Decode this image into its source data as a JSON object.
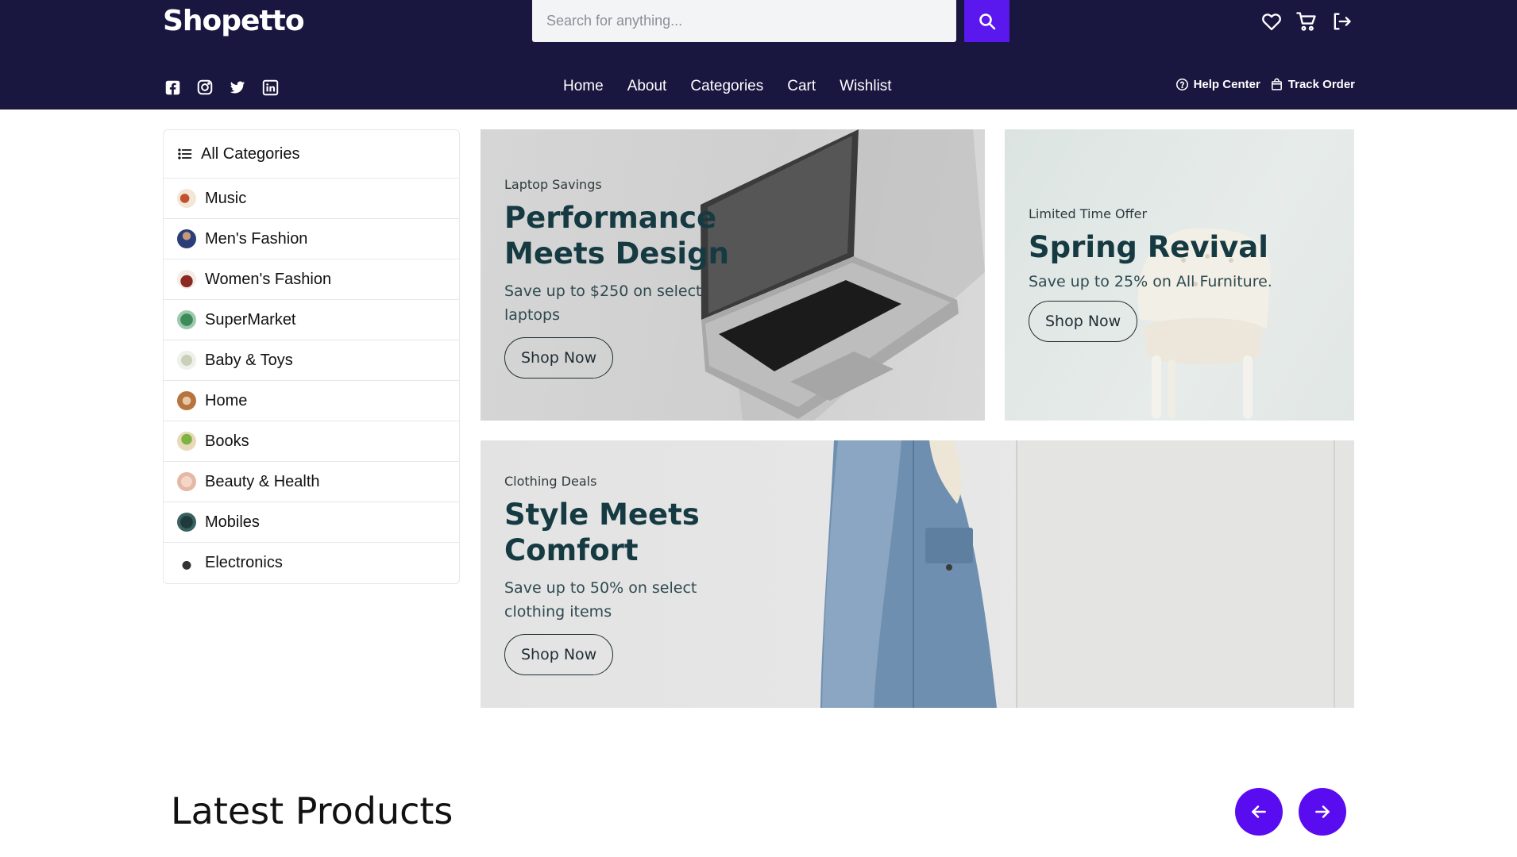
{
  "header": {
    "logo": "Shopetto",
    "search": {
      "placeholder": "Search for anything..."
    },
    "icons": [
      "heart-icon",
      "cart-icon",
      "logout-icon",
      "search-icon"
    ],
    "socials": [
      "facebook-icon",
      "instagram-icon",
      "twitter-icon",
      "linkedin-icon"
    ],
    "nav": [
      {
        "label": "Home"
      },
      {
        "label": "About"
      },
      {
        "label": "Categories"
      },
      {
        "label": "Cart"
      },
      {
        "label": "Wishlist"
      }
    ],
    "utility": [
      {
        "label": "Help Center",
        "icon": "help-circle-icon"
      },
      {
        "label": "Track Order",
        "icon": "bag-icon"
      }
    ]
  },
  "sidebar": {
    "title": "All Categories",
    "items": [
      {
        "label": "Music"
      },
      {
        "label": "Men's Fashion"
      },
      {
        "label": "Women's Fashion"
      },
      {
        "label": "SuperMarket"
      },
      {
        "label": "Baby & Toys"
      },
      {
        "label": "Home"
      },
      {
        "label": "Books"
      },
      {
        "label": "Beauty & Health"
      },
      {
        "label": "Mobiles"
      },
      {
        "label": "Electronics"
      }
    ]
  },
  "banners": [
    {
      "eyebrow": "Laptop Savings",
      "title_line1": "Performance",
      "title_line2": "Meets Design",
      "sub_line1": "Save up to $250 on select",
      "sub_line2": "laptops",
      "button": "Shop Now"
    },
    {
      "eyebrow": "Limited Time Offer",
      "title_line1": "Spring Revival",
      "sub_line1": "Save up to 25% on All Furniture.",
      "button": "Shop Now"
    },
    {
      "eyebrow": "Clothing Deals",
      "title_line1": "Style Meets",
      "title_line2": "Comfort",
      "sub_line1": "Save up to 50% on select",
      "sub_line2": "clothing items",
      "button": "Shop Now"
    }
  ],
  "latest": {
    "title": "Latest Products"
  },
  "colors": {
    "header_bg": "#191640",
    "accent": "#5a17ee",
    "banner_title": "#163a42"
  }
}
